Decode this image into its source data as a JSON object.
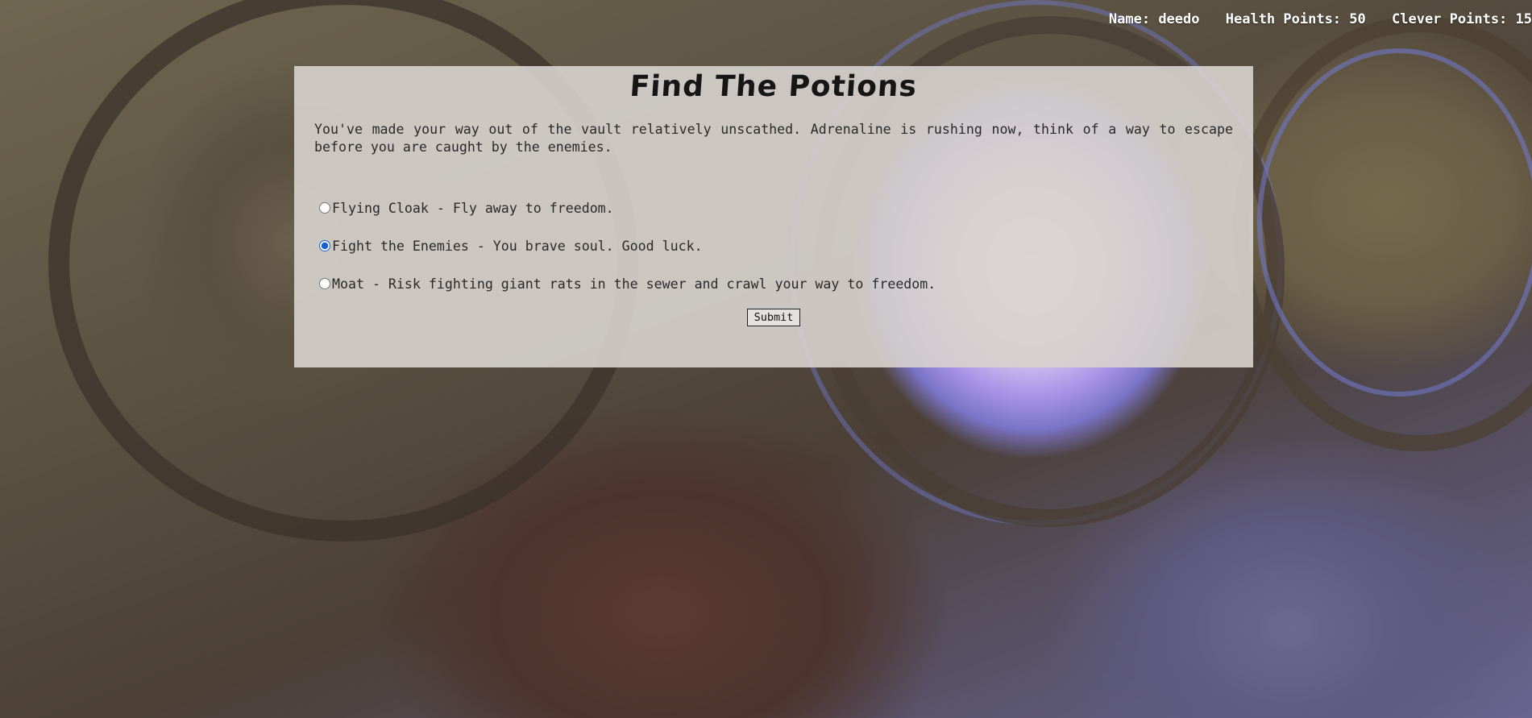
{
  "hud": {
    "name": "Name: deedo",
    "health": "Health Points: 50",
    "clever": "Clever Points: 15"
  },
  "scene": {
    "title": "Find The Potions",
    "description": "You've made your way out of the vault relatively unscathed. Adrenaline is rushing now, think of a way to escape before you are caught by the enemies.",
    "options": [
      {
        "label": "Flying Cloak - Fly away to freedom.",
        "selected": false
      },
      {
        "label": "Fight the Enemies - You brave soul. Good luck.",
        "selected": true
      },
      {
        "label": "Moat - Risk fighting giant rats in the sewer and crawl your way to freedom.",
        "selected": false
      }
    ],
    "submit_label": "Submit"
  }
}
